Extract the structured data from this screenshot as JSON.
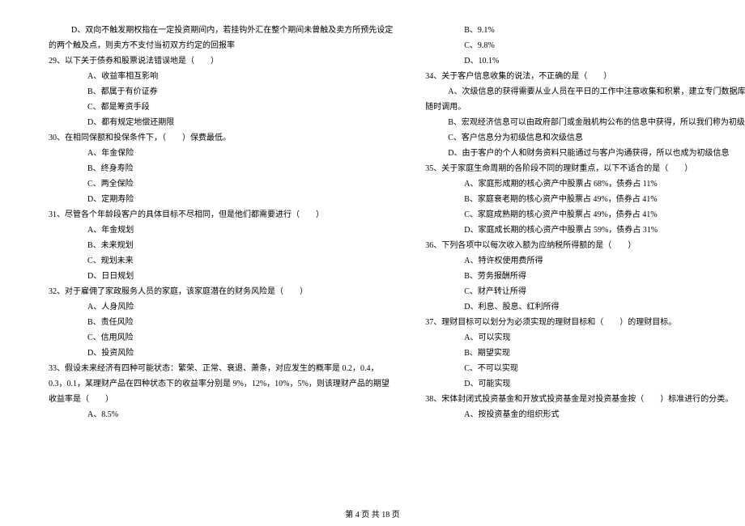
{
  "left_column": [
    {
      "cls": "indent-0",
      "text": "D、双向不触发期权指在一定投资期间内，若挂钩外汇在整个期间未曾触及卖方所预先设定"
    },
    {
      "cls": "q-start",
      "text": "的两个触及点，则卖方不支付当初双方约定的回报率"
    },
    {
      "cls": "q-start",
      "text": "29、以下关于债券和股票说法错误地是（　　）"
    },
    {
      "cls": "indent-1",
      "text": "A、收益率相互影响"
    },
    {
      "cls": "indent-1",
      "text": "B、都属于有价证券"
    },
    {
      "cls": "indent-1",
      "text": "C、都是筹资手段"
    },
    {
      "cls": "indent-1",
      "text": "D、都有规定地偿还期限"
    },
    {
      "cls": "q-start",
      "text": "30、在相同保额和投保条件下，（　　）保费最低。"
    },
    {
      "cls": "indent-1",
      "text": "A、年金保险"
    },
    {
      "cls": "indent-1",
      "text": "B、终身寿险"
    },
    {
      "cls": "indent-1",
      "text": "C、两全保险"
    },
    {
      "cls": "indent-1",
      "text": "D、定期寿险"
    },
    {
      "cls": "q-start",
      "text": "31、尽管各个年龄段客户的具体目标不尽相同，但是他们都需要进行（　　）"
    },
    {
      "cls": "indent-1",
      "text": "A、年金规划"
    },
    {
      "cls": "indent-1",
      "text": "B、未来规划"
    },
    {
      "cls": "indent-1",
      "text": "C、规划未来"
    },
    {
      "cls": "indent-1",
      "text": "D、日日规划"
    },
    {
      "cls": "q-start",
      "text": "32、对于雇佣了家政服务人员的家庭，该家庭潜在的财务风险是（　　）"
    },
    {
      "cls": "indent-1",
      "text": "A、人身风险"
    },
    {
      "cls": "indent-1",
      "text": "B、责任风险"
    },
    {
      "cls": "indent-1",
      "text": "C、信用风险"
    },
    {
      "cls": "indent-1",
      "text": "D、投资风险"
    },
    {
      "cls": "q-start",
      "text": "33、假设未来经济有四种可能状态：繁荣、正常、衰退、萧条，对应发生的概率是 0.2，0.4，"
    },
    {
      "cls": "q-start",
      "text": "0.3，0.1，某理财产品在四种状态下的收益率分别是 9%，12%，10%，5%，则该理财产品的期望"
    },
    {
      "cls": "q-start",
      "text": "收益率是（　　）"
    },
    {
      "cls": "indent-1",
      "text": "A、8.5%"
    }
  ],
  "right_column": [
    {
      "cls": "indent-1",
      "text": "B、9.1%"
    },
    {
      "cls": "indent-1",
      "text": "C、9.8%"
    },
    {
      "cls": "indent-1",
      "text": "D、10.1%"
    },
    {
      "cls": "q-start",
      "text": "34、关于客户信息收集的说法，不正确的是（　　）"
    },
    {
      "cls": "indent-0",
      "text": "A、次级信息的获得需要从业人员在平日的工作中注意收集和积累，建立专门数据库，以便"
    },
    {
      "cls": "q-start",
      "text": "随时调用。"
    },
    {
      "cls": "indent-0",
      "text": "B、宏观经济信息可以由政府部门或金融机构公布的信息中获得，所以我们称为初级信息"
    },
    {
      "cls": "indent-0",
      "text": "C、客户信息分为初级信息和次级信息"
    },
    {
      "cls": "indent-0",
      "text": "D、由于客户的个人和财务资料只能通过与客户沟通获得，所以也成为初级信息"
    },
    {
      "cls": "q-start",
      "text": "35、关于家庭生命周期的各阶段不同的理财重点，以下不适合的是（　　）"
    },
    {
      "cls": "indent-1",
      "text": "A、家庭形成期的核心资产中股票占 68%，债券占 11%"
    },
    {
      "cls": "indent-1",
      "text": "B、家庭衰老期的核心资产中股票占 49%，债券占 41%"
    },
    {
      "cls": "indent-1",
      "text": "C、家庭成熟期的核心资产中股票占 49%，债券占 41%"
    },
    {
      "cls": "indent-1",
      "text": "D、家庭成长期的核心资产中股票占 59%，债券占 31%"
    },
    {
      "cls": "q-start",
      "text": "36、下列各项中以每次收入额为应纳税所得额的是（　　）"
    },
    {
      "cls": "indent-1",
      "text": "A、特许权使用费所得"
    },
    {
      "cls": "indent-1",
      "text": "B、劳务报酬所得"
    },
    {
      "cls": "indent-1",
      "text": "C、财产转让所得"
    },
    {
      "cls": "indent-1",
      "text": "D、利息、股息、红利所得"
    },
    {
      "cls": "q-start",
      "text": "37、理财目标可以划分为必须实现的理财目标和（　　）的理财目标。"
    },
    {
      "cls": "indent-1",
      "text": "A、可以实现"
    },
    {
      "cls": "indent-1",
      "text": "B、期望实现"
    },
    {
      "cls": "indent-1",
      "text": "C、不可以实现"
    },
    {
      "cls": "indent-1",
      "text": "D、可能实现"
    },
    {
      "cls": "q-start",
      "text": "38、宋体封闭式投资基金和开放式投资基金是对投资基金按（　　）标准进行的分类。"
    },
    {
      "cls": "indent-1",
      "text": "A、按投资基金的组织形式"
    }
  ],
  "footer": "第 4 页 共 18 页"
}
